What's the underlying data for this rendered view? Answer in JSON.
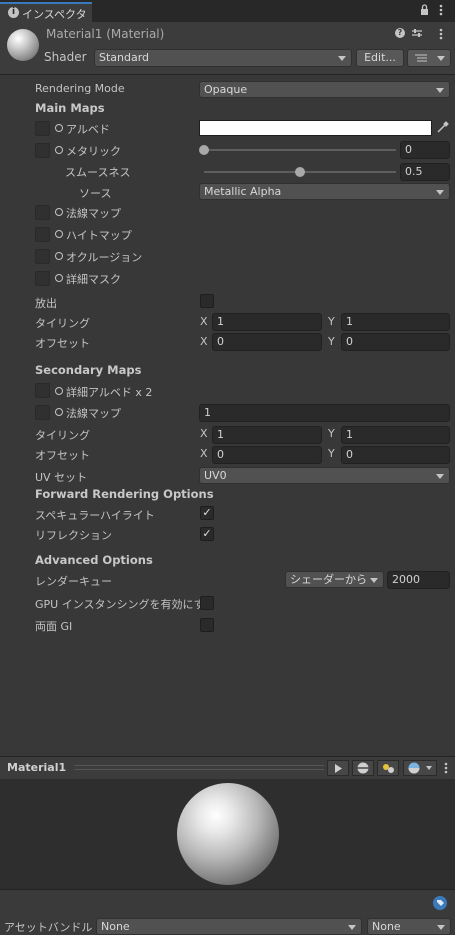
{
  "tab": {
    "title": "インスペクター"
  },
  "header": {
    "material_title": "Material1 (Material)",
    "shader_label": "Shader",
    "shader_value": "Standard",
    "edit_button": "Edit..."
  },
  "rendering": {
    "label": "Rendering Mode",
    "value": "Opaque"
  },
  "main_maps": {
    "title": "Main Maps",
    "albedo": "アルベド",
    "metallic": "メタリック",
    "metallic_value": "0",
    "metallic_level": 0,
    "smoothness": "スムースネス",
    "smoothness_value": "0.5",
    "smoothness_level": 0.5,
    "source": "ソース",
    "source_value": "Metallic Alpha",
    "normal": "法線マップ",
    "height": "ハイトマップ",
    "occlusion": "オクルージョン",
    "detail_mask": "詳細マスク",
    "emission": "放出",
    "tiling": "タイリング",
    "offset": "オフセット",
    "tiling_x": "1",
    "tiling_y": "1",
    "offset_x": "0",
    "offset_y": "0"
  },
  "secondary_maps": {
    "title": "Secondary Maps",
    "detail_albedo": "詳細アルベド x 2",
    "normal": "法線マップ",
    "normal_value": "1",
    "tiling": "タイリング",
    "offset": "オフセット",
    "tiling_x": "1",
    "tiling_y": "1",
    "offset_x": "0",
    "offset_y": "0",
    "uv_label": "UV セット",
    "uv_value": "UV0"
  },
  "axis": {
    "x": "X",
    "y": "Y"
  },
  "forward": {
    "title": "Forward Rendering Options",
    "specular": "スペキュラーハイライト",
    "reflection": "リフレクション",
    "specular_checked": "✓",
    "reflection_checked": "✓"
  },
  "advanced": {
    "title": "Advanced Options",
    "render_queue": "レンダーキュー",
    "render_queue_mode": "シェーダーから",
    "render_queue_value": "2000",
    "gpu_instancing": "GPU インスタンシングを有効にする",
    "double_gi": "両面 GI"
  },
  "preview": {
    "title": "Material1"
  },
  "bottom": {
    "asset_bundle_label": "アセットバンドル",
    "bundle_value": "None",
    "variant_value": "None"
  },
  "icons": {
    "info": "info-icon",
    "lock": "lock-icon",
    "menu": "kebab-menu-icon",
    "help": "help-icon",
    "settings": "preset-icon",
    "eyedropper": "eyedropper-icon",
    "play": "play-icon",
    "tag": "tag-icon"
  },
  "colors": {
    "background": "#383838",
    "albedo_color": "#ffffff",
    "accent": "#3a79bb"
  }
}
